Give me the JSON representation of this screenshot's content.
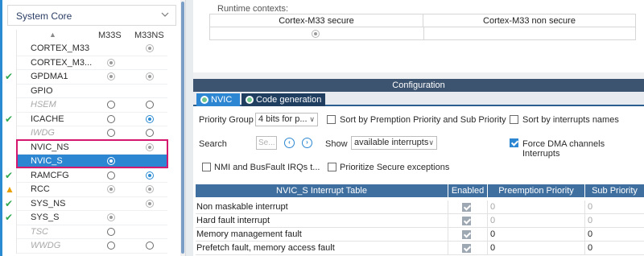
{
  "left_panel": {
    "category_title": "System Core",
    "columns": [
      "M33S",
      "M33NS"
    ],
    "items": [
      {
        "label": "CORTEX_M33",
        "status": "",
        "style": "normal",
        "m33s": "none",
        "m33ns": "disabled-checked"
      },
      {
        "label": "CORTEX_M3...",
        "status": "",
        "style": "normal",
        "m33s": "disabled-checked",
        "m33ns": "none"
      },
      {
        "label": "GPDMA1",
        "status": "check",
        "style": "normal",
        "m33s": "disabled-checked",
        "m33ns": "disabled-checked"
      },
      {
        "label": "GPIO",
        "status": "",
        "style": "normal",
        "m33s": "none",
        "m33ns": "none"
      },
      {
        "label": "HSEM",
        "status": "",
        "style": "gray",
        "m33s": "empty",
        "m33ns": "empty"
      },
      {
        "label": "ICACHE",
        "status": "check",
        "style": "normal",
        "m33s": "empty",
        "m33ns": "selected"
      },
      {
        "label": "IWDG",
        "status": "",
        "style": "gray",
        "m33s": "empty",
        "m33ns": "empty"
      },
      {
        "label": "NVIC_NS",
        "status": "",
        "style": "normal",
        "m33s": "none",
        "m33ns": "disabled-checked"
      },
      {
        "label": "NVIC_S",
        "status": "",
        "style": "selected",
        "m33s": "white",
        "m33ns": "none"
      },
      {
        "label": "RAMCFG",
        "status": "check",
        "style": "normal",
        "m33s": "empty",
        "m33ns": "selected"
      },
      {
        "label": "RCC",
        "status": "warning",
        "style": "normal",
        "m33s": "disabled-checked",
        "m33ns": "disabled-checked"
      },
      {
        "label": "SYS_NS",
        "status": "check",
        "style": "normal",
        "m33s": "none",
        "m33ns": "disabled-checked"
      },
      {
        "label": "SYS_S",
        "status": "check",
        "style": "normal",
        "m33s": "disabled-checked",
        "m33ns": "none"
      },
      {
        "label": "TSC",
        "status": "",
        "style": "gray",
        "m33s": "empty",
        "m33ns": "none"
      },
      {
        "label": "WWDG",
        "status": "",
        "style": "gray",
        "m33s": "empty",
        "m33ns": "empty"
      }
    ]
  },
  "runtime": {
    "label": "Runtime contexts:",
    "columns": [
      "Cortex-M33 secure",
      "Cortex-M33 non secure"
    ]
  },
  "configuration": {
    "title": "Configuration",
    "tabs": [
      {
        "label": "NVIC"
      },
      {
        "label": "Code generation"
      }
    ],
    "priority_group_label": "Priority Group",
    "priority_group_value": "4 bits for p...",
    "sort_premption_label": "Sort by Premption Priority and Sub Priority",
    "sort_names_label": "Sort by interrupts names",
    "search_label": "Search",
    "search_placeholder": "Se...",
    "show_label": "Show",
    "show_value": "available interrupts",
    "force_dma_label": "Force DMA channels Interrupts",
    "nmi_label": "NMI and BusFault IRQs t...",
    "prioritize_label": "Prioritize Secure exceptions",
    "checks": {
      "sort_premption": false,
      "sort_names": false,
      "force_dma": true,
      "nmi": false,
      "prioritize": false
    }
  },
  "nvic_table": {
    "headers": [
      "NVIC_S Interrupt Table",
      "Enabled",
      "Preemption Priority",
      "Sub Priority"
    ],
    "rows": [
      {
        "name": "Non maskable interrupt",
        "enabled": true,
        "preemption": "0",
        "sub": "0",
        "dim": true
      },
      {
        "name": "Hard fault interrupt",
        "enabled": true,
        "preemption": "0",
        "sub": "0",
        "dim": true
      },
      {
        "name": "Memory management fault",
        "enabled": true,
        "preemption": "0",
        "sub": "0",
        "dim": false
      },
      {
        "name": "Prefetch fault, memory access fault",
        "enabled": true,
        "preemption": "0",
        "sub": "0",
        "dim": false
      }
    ]
  }
}
